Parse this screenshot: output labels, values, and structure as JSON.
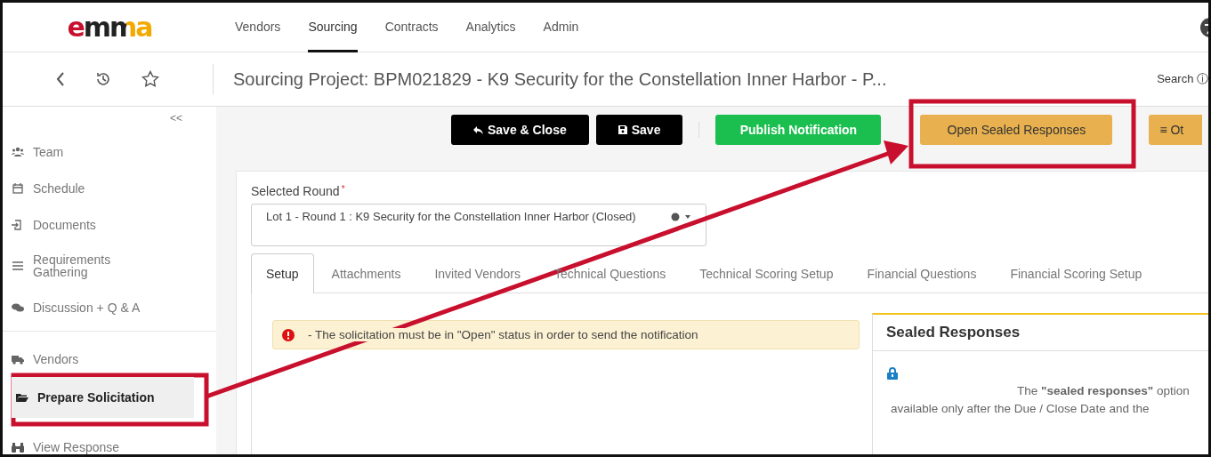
{
  "logo": {
    "text": "emma"
  },
  "top_nav": [
    {
      "label": "Vendors",
      "selected": false
    },
    {
      "label": "Sourcing",
      "selected": true
    },
    {
      "label": "Contracts",
      "selected": false
    },
    {
      "label": "Analytics",
      "selected": false
    },
    {
      "label": "Admin",
      "selected": false
    }
  ],
  "header": {
    "title": "Sourcing Project: BPM021829 - K9 Security for the Constellation Inner Harbor - P...",
    "search_label": "Search ⓘ"
  },
  "sidebar": {
    "collapse": "<<",
    "items": [
      {
        "label": "Team",
        "selected": false
      },
      {
        "label": "Schedule",
        "selected": false
      },
      {
        "label": "Documents",
        "selected": false
      },
      {
        "label": "Requirements Gathering",
        "selected": false
      },
      {
        "label": "Discussion + Q & A",
        "selected": false
      },
      {
        "label": "Vendors",
        "selected": false
      },
      {
        "label": "Prepare Solicitation",
        "selected": true
      },
      {
        "label": "View Response",
        "selected": false
      }
    ]
  },
  "toolbar": [
    {
      "label": "Save & Close",
      "kind": "dark"
    },
    {
      "label": "Save",
      "kind": "dark"
    },
    {
      "label": "Publish Notification",
      "kind": "green"
    },
    {
      "label": "Open Sealed Responses",
      "kind": "amber"
    },
    {
      "label": "≡ Ot",
      "kind": "amber"
    }
  ],
  "round": {
    "label": "Selected Round",
    "required": "*",
    "value": "Lot 1 - Round 1 : K9 Security for the Constellation Inner Harbor (Closed)"
  },
  "tabs": [
    {
      "label": "Setup",
      "selected": true
    },
    {
      "label": "Attachments",
      "selected": false
    },
    {
      "label": "Invited Vendors",
      "selected": false
    },
    {
      "label": "Technical Questions",
      "selected": false
    },
    {
      "label": "Technical Scoring Setup",
      "selected": false
    },
    {
      "label": "Financial Questions",
      "selected": false
    },
    {
      "label": "Financial Scoring Setup",
      "selected": false
    }
  ],
  "alert": {
    "text": "- The solicitation must be in \"Open\" status in order to send the notification"
  },
  "sealed_panel": {
    "title": "Sealed Responses",
    "line_1": "The **\"sealed responses\"** option",
    "line_2": "available only after the Due / Close Date and the"
  }
}
